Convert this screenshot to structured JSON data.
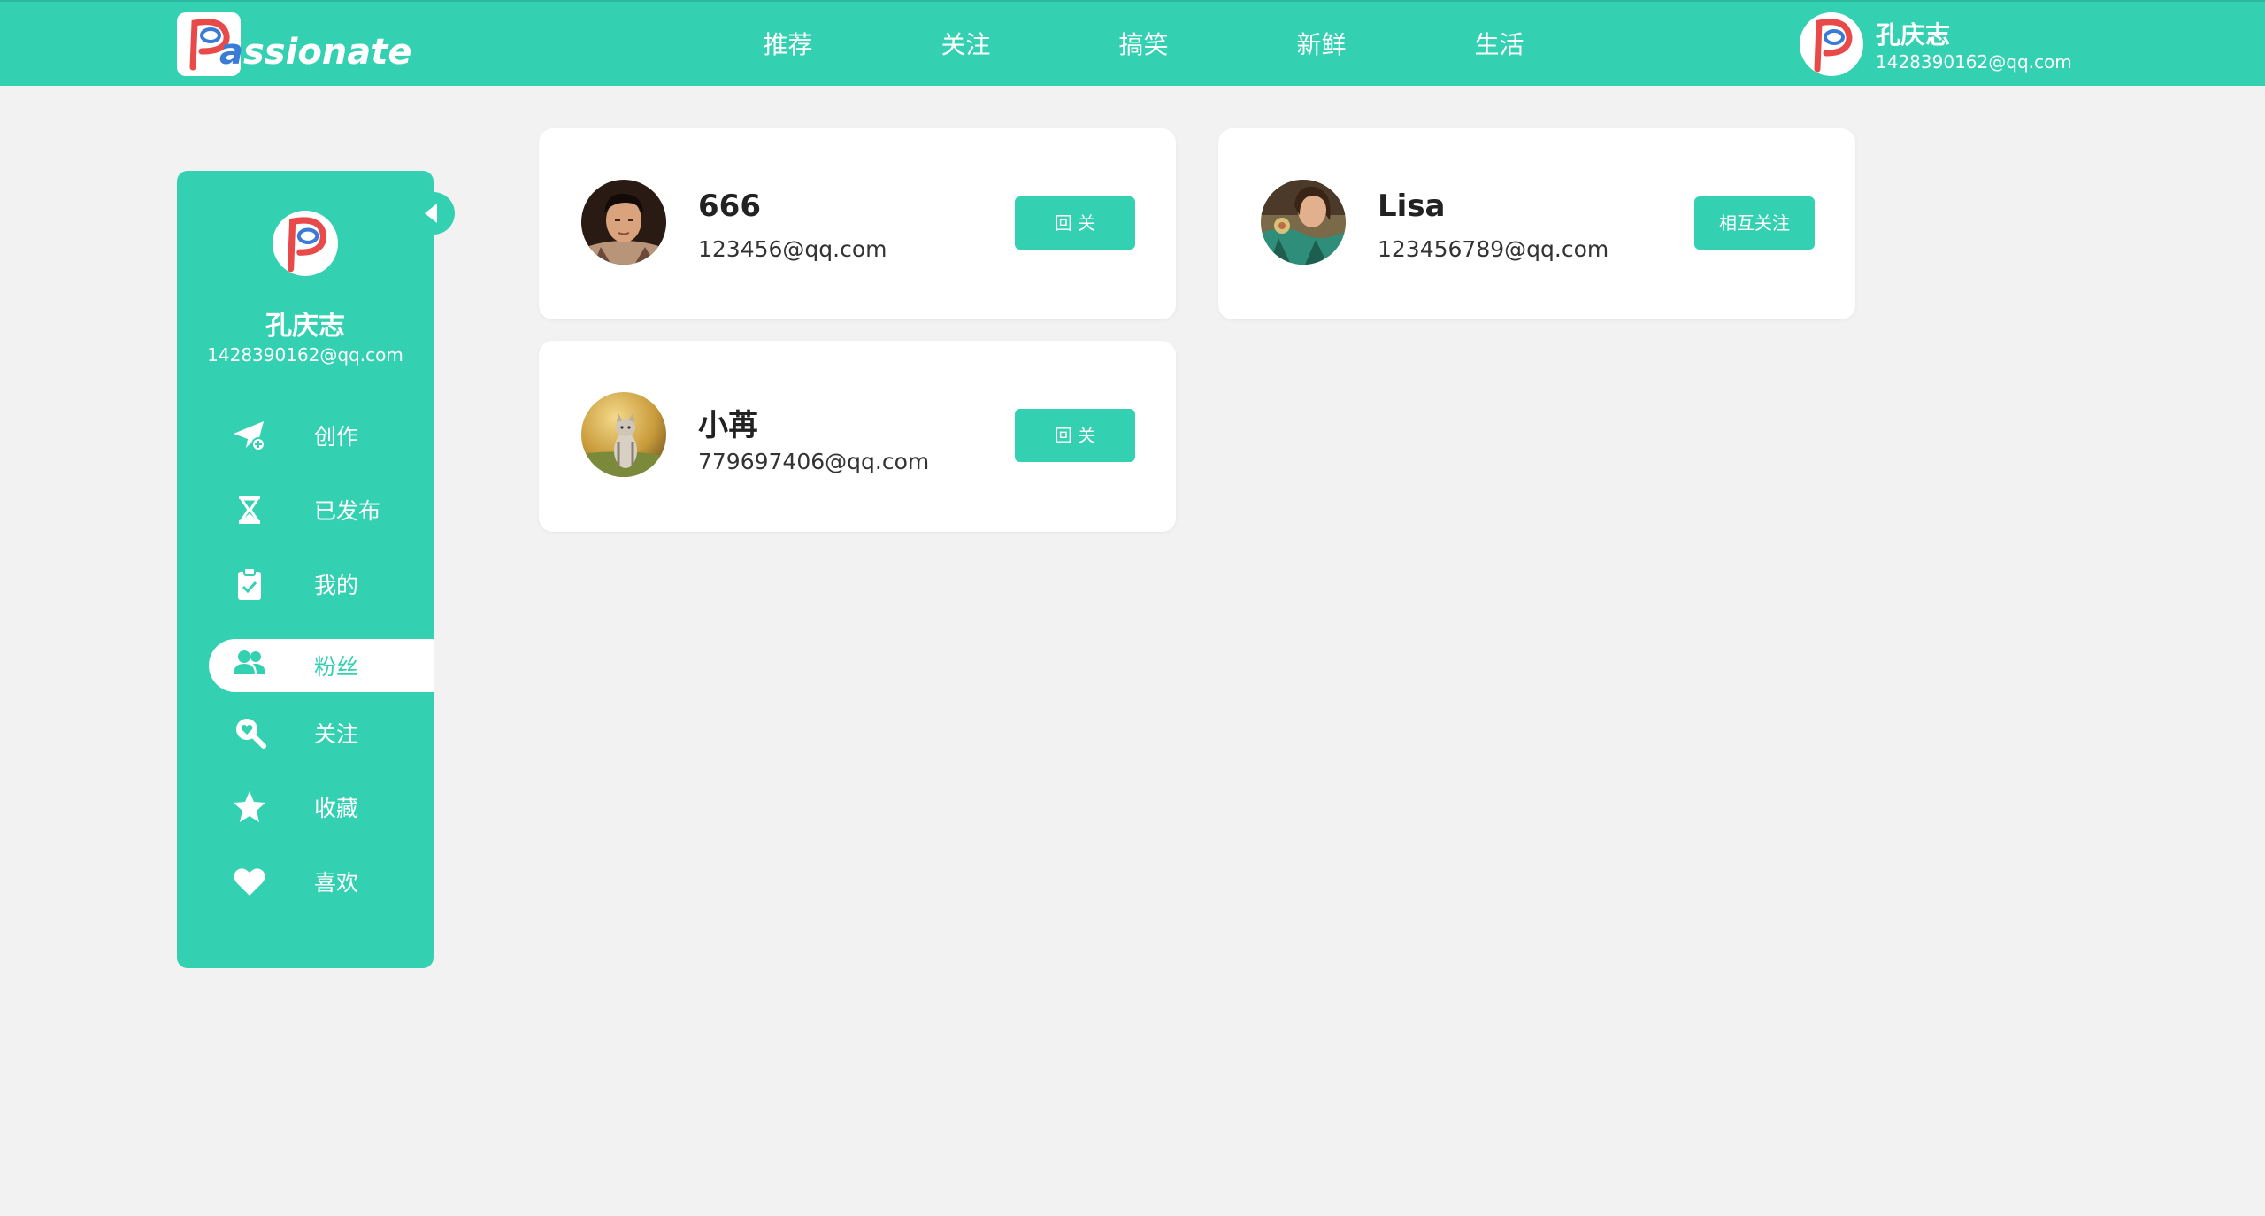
{
  "header": {
    "logo_text_a": "a",
    "logo_text_rest": "ssionate",
    "nav": [
      "推荐",
      "关注",
      "搞笑",
      "新鲜",
      "生活"
    ],
    "user": {
      "name": "孔庆志",
      "email": "1428390162@qq.com"
    }
  },
  "sidebar": {
    "name": "孔庆志",
    "email": "1428390162@qq.com",
    "items": [
      {
        "label": "创作",
        "icon": "paper-plane-icon"
      },
      {
        "label": "已发布",
        "icon": "hourglass-icon"
      },
      {
        "label": "我的",
        "icon": "clipboard-check-icon"
      },
      {
        "label": "粉丝",
        "icon": "users-icon",
        "active": true
      },
      {
        "label": "关注",
        "icon": "search-heart-icon"
      },
      {
        "label": "收藏",
        "icon": "star-icon"
      },
      {
        "label": "喜欢",
        "icon": "heart-icon"
      }
    ]
  },
  "fans": [
    {
      "name": "666",
      "email": "123456@qq.com",
      "button": "回 关"
    },
    {
      "name": "Lisa",
      "email": "123456789@qq.com",
      "button": "相互关注"
    },
    {
      "name": "小苒",
      "email": "779697406@qq.com",
      "button": "回 关"
    }
  ],
  "colors": {
    "accent": "#34d0b2",
    "background": "#f2f2f2",
    "card": "#ffffff",
    "logo_red": "#e84a4a",
    "logo_blue": "#3a7bd5"
  }
}
